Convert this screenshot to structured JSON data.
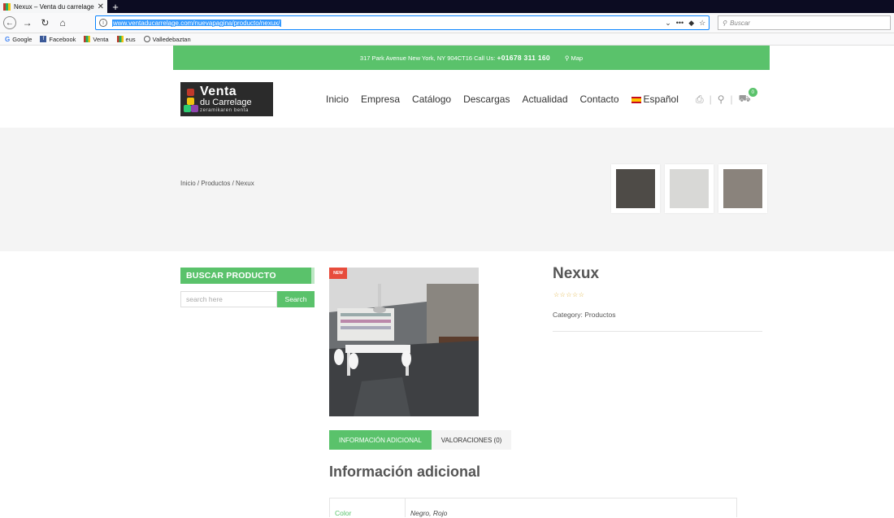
{
  "browser": {
    "tab_title": "Nexux – Venta du carrelage",
    "url": "www.ventaducarrelage.com/nuevapagina/producto/nexux/",
    "search_placeholder": "Buscar",
    "bookmarks": [
      "Google",
      "Facebook",
      "Venta",
      "eus",
      "Valledebaztan"
    ]
  },
  "topbar": {
    "address": "317 Park Avenue New York, NY 904CT16 Call Us:",
    "phone": "+01678 311 160",
    "map": "Map"
  },
  "logo": {
    "line1": "Venta",
    "line2": "du Carrelage",
    "line3": "zeramikaren benta"
  },
  "nav": [
    "Inicio",
    "Empresa",
    "Catálogo",
    "Descargas",
    "Actualidad",
    "Contacto",
    "Español"
  ],
  "cart_count": "0",
  "breadcrumb": "Inicio / Productos / Nexux",
  "thumb_colors": [
    "#4e4b47",
    "#d8d8d6",
    "#8a837c"
  ],
  "sidebar": {
    "title": "BUSCAR PRODUCTO",
    "search_placeholder": "search here",
    "search_button": "Search"
  },
  "product": {
    "badge": "NEW",
    "title": "Nexux",
    "stars": "☆☆☆☆☆",
    "category": "Category: Productos"
  },
  "tabs": {
    "info": "INFORMACIÓN ADICIONAL",
    "reviews": "VALORACIONES (0)"
  },
  "additional": {
    "title": "Información adicional",
    "rows": [
      {
        "label": "Color",
        "value": "Negro, Rojo"
      }
    ]
  }
}
